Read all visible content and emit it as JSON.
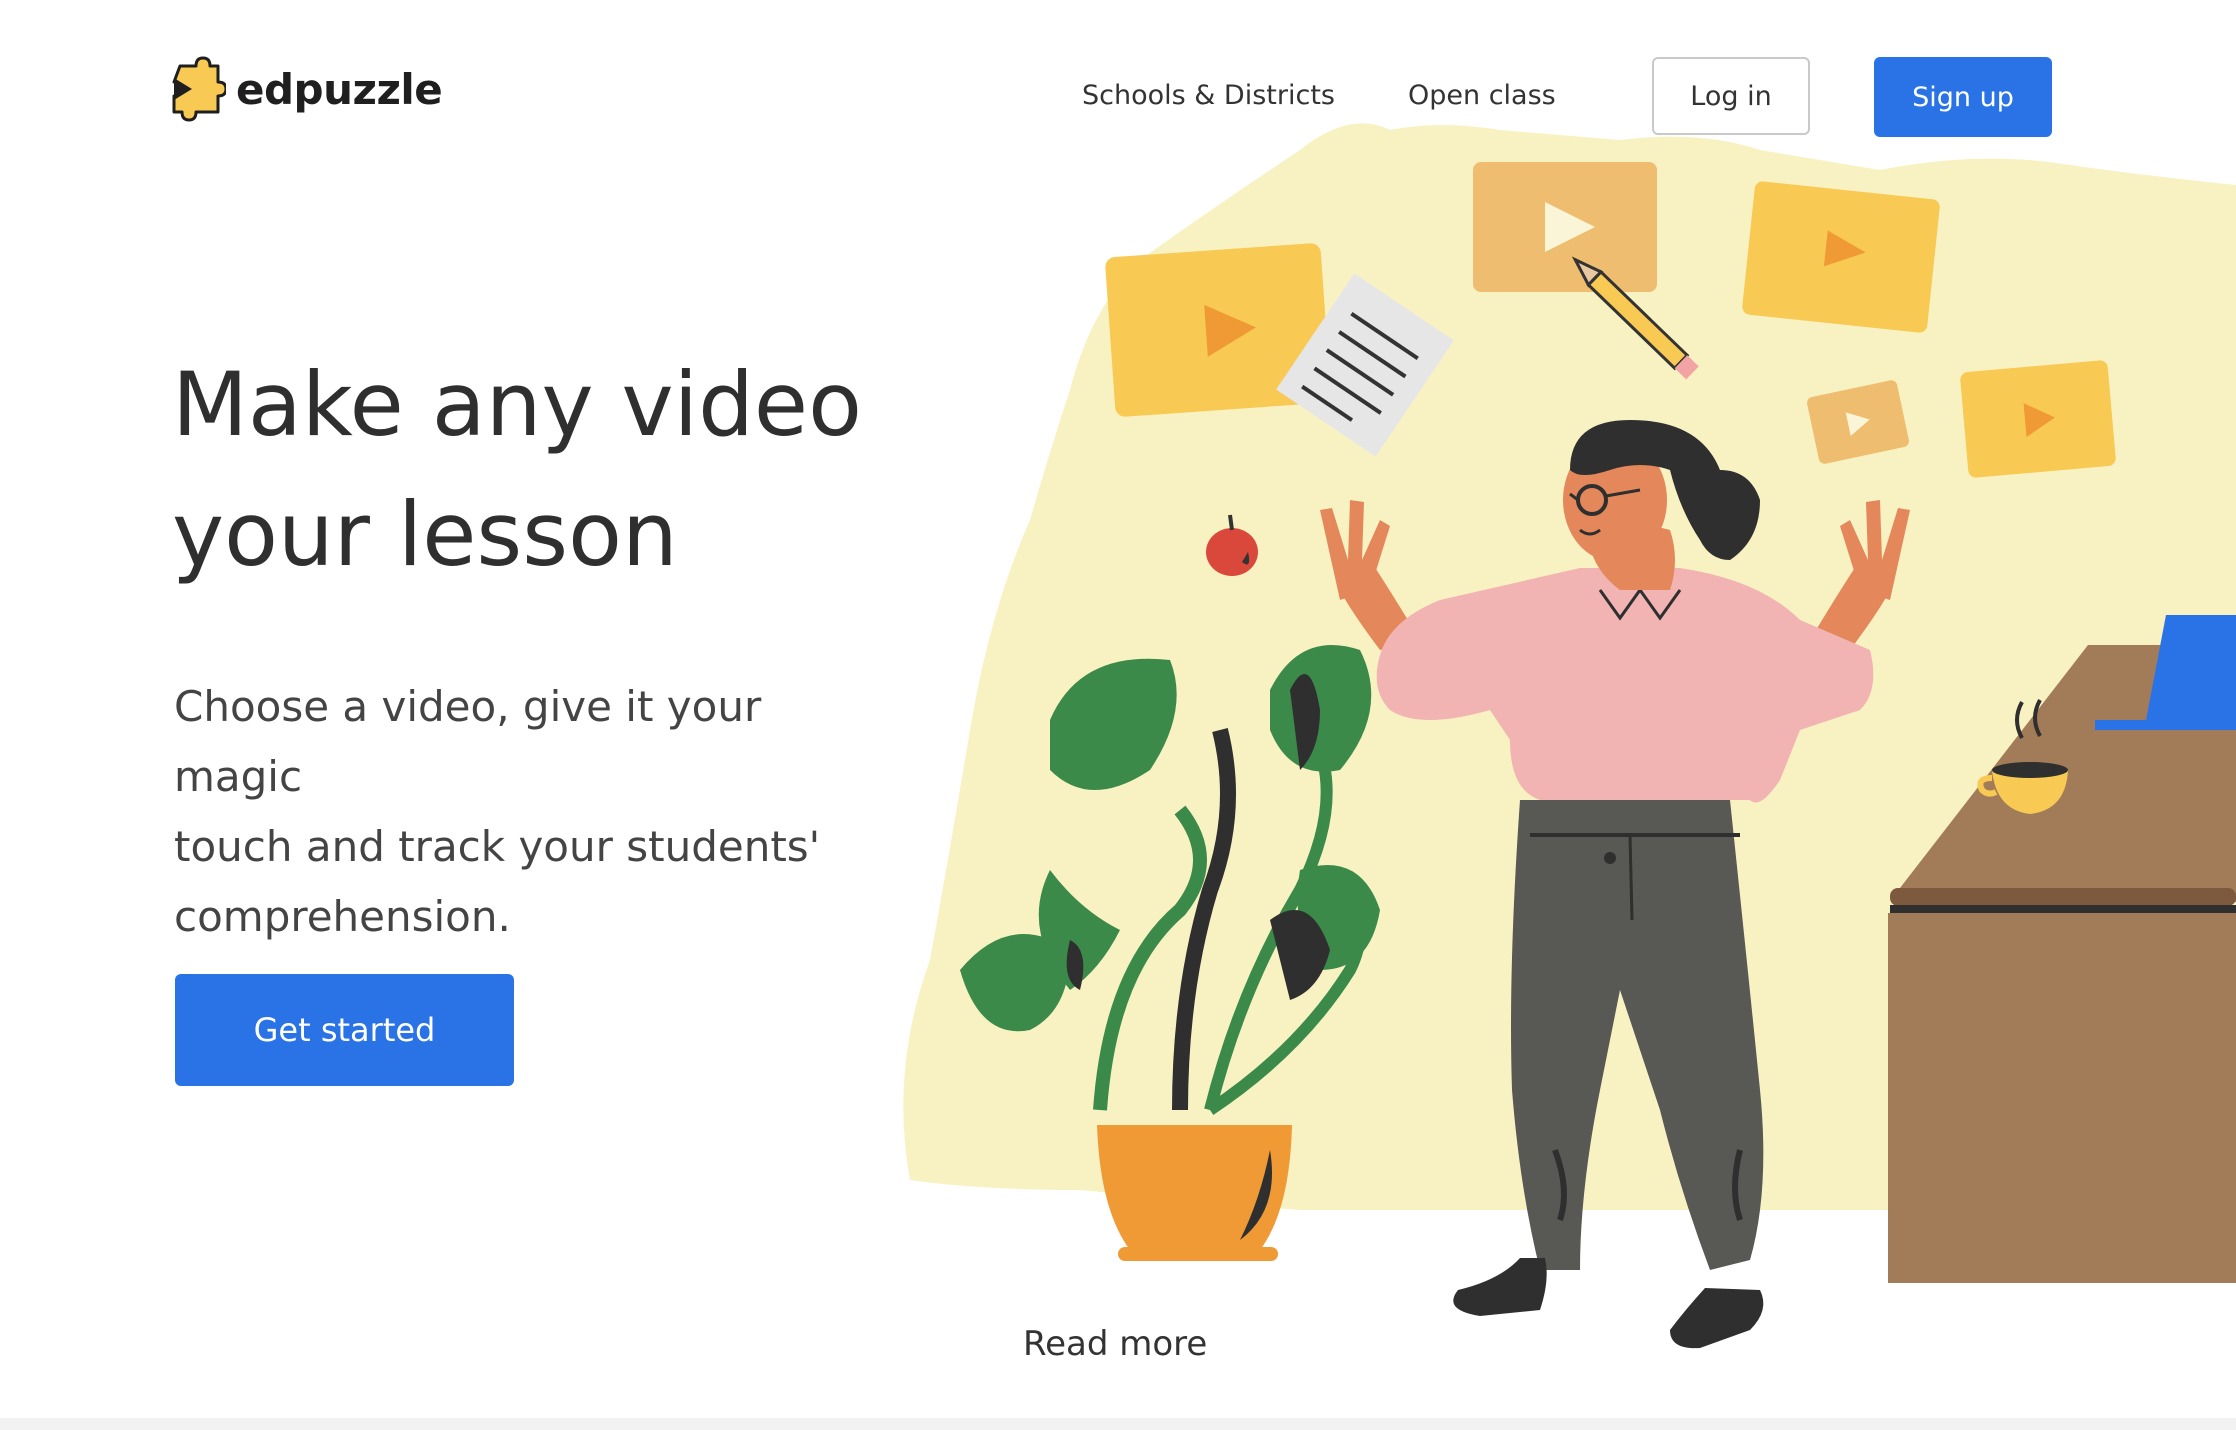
{
  "header": {
    "logo_text": "edpuzzle",
    "nav": [
      {
        "label": "Schools & Districts"
      },
      {
        "label": "Open class"
      }
    ],
    "login_label": "Log in",
    "signup_label": "Sign up"
  },
  "hero": {
    "title_line1": "Make any video",
    "title_line2": "your lesson",
    "subtitle_line1": "Choose a video, give it your magic",
    "subtitle_line2": "touch and track your students'",
    "subtitle_line3": "comprehension.",
    "cta_label": "Get started"
  },
  "read_more_label": "Read more",
  "colors": {
    "primary_blue": "#2a73e6",
    "backdrop_yellow": "#f8f2c2",
    "video_yellow": "#f8c953",
    "play_orange": "#ef9a35",
    "shirt_pink": "#f2b3b3",
    "pants_gray": "#585854",
    "desk_brown": "#a27c58",
    "plant_green": "#3c8a4a",
    "pot_orange": "#f09a35"
  }
}
